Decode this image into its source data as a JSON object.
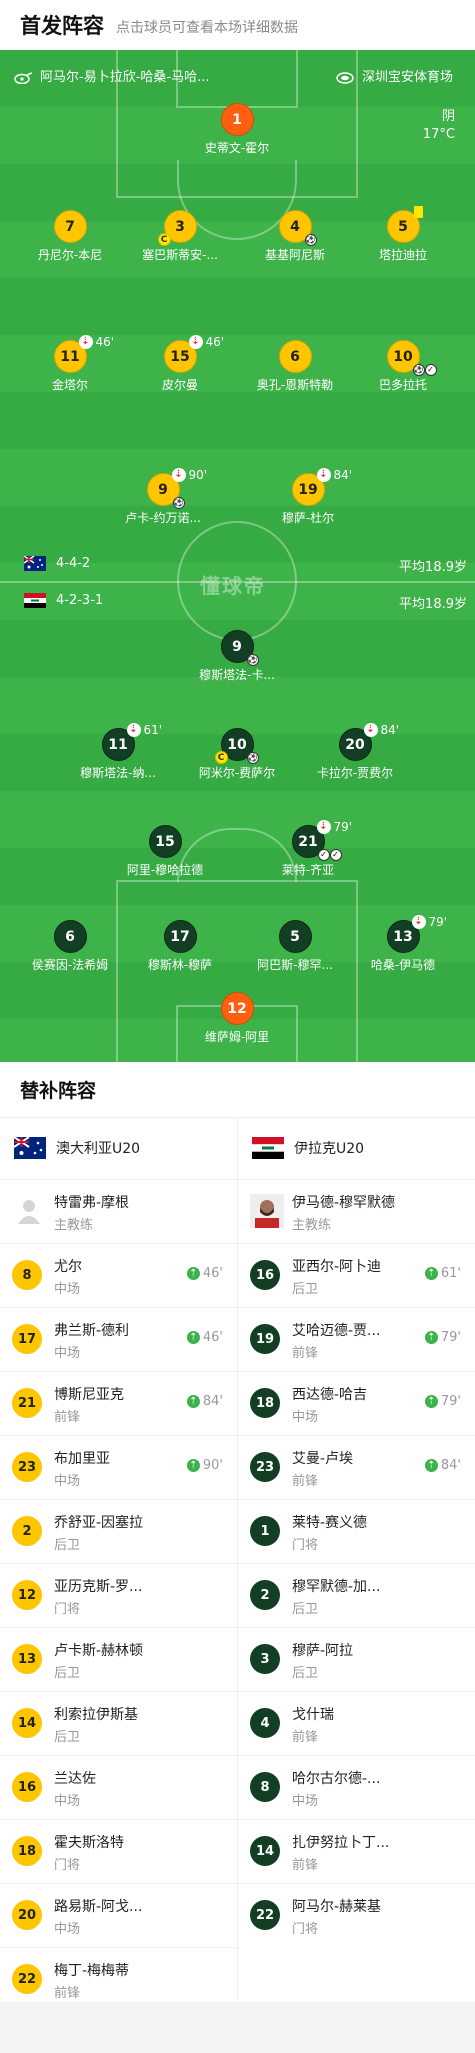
{
  "header": {
    "title": "首发阵容",
    "subtitle": "点击球员可查看本场详细数据"
  },
  "match": {
    "referee": "阿马尔-易卜拉欣-哈桑-马哈...",
    "venue": "深圳宝安体育场",
    "weather": "阴",
    "temperature": "17°C",
    "watermark": "懂球帝"
  },
  "home": {
    "formation": "4-4-2",
    "avg_age": "平均18.9岁",
    "name": "澳大利亚U20",
    "coach": "特雷弗-摩根",
    "coach_role": "主教练"
  },
  "away": {
    "formation": "4-2-3-1",
    "avg_age": "平均18.9岁",
    "name": "伊拉克U20",
    "coach": "伊马德-穆罕默德",
    "coach_role": "主教练"
  },
  "home_players": [
    {
      "num": "1",
      "name": "史蒂文-霍尔"
    },
    {
      "num": "7",
      "name": "丹尼尔-本尼"
    },
    {
      "num": "3",
      "name": "塞巴斯蒂安-..."
    },
    {
      "num": "4",
      "name": "基基阿尼斯"
    },
    {
      "num": "5",
      "name": "塔拉迪拉"
    },
    {
      "num": "11",
      "name": "金塔尔",
      "sub": "46'"
    },
    {
      "num": "15",
      "name": "皮尔曼",
      "sub": "46'"
    },
    {
      "num": "6",
      "name": "奥孔-恩斯特勒"
    },
    {
      "num": "10",
      "name": "巴多拉托"
    },
    {
      "num": "9",
      "name": "卢卡-约万诺...",
      "sub": "90'"
    },
    {
      "num": "19",
      "name": "穆萨-杜尔",
      "sub": "84'"
    }
  ],
  "away_players": [
    {
      "num": "9",
      "name": "穆斯塔法-卡..."
    },
    {
      "num": "11",
      "name": "穆斯塔法-纳...",
      "sub": "61'"
    },
    {
      "num": "10",
      "name": "阿米尔-费萨尔"
    },
    {
      "num": "20",
      "name": "卡拉尔-贾费尔",
      "sub": "84'"
    },
    {
      "num": "15",
      "name": "阿里-穆哈拉德"
    },
    {
      "num": "21",
      "name": "莱特-齐亚",
      "sub": "79'"
    },
    {
      "num": "6",
      "name": "侯赛因-法希姆"
    },
    {
      "num": "17",
      "name": "穆斯林-穆萨"
    },
    {
      "num": "5",
      "name": "阿巴斯-穆罕..."
    },
    {
      "num": "13",
      "name": "哈桑-伊马德",
      "sub": "79'"
    },
    {
      "num": "12",
      "name": "维萨姆-阿里"
    }
  ],
  "subs": {
    "title": "替补阵容",
    "home": [
      {
        "num": "8",
        "name": "尤尔",
        "pos": "中场",
        "time": "46'"
      },
      {
        "num": "17",
        "name": "弗兰斯-德利",
        "pos": "中场",
        "time": "46'"
      },
      {
        "num": "21",
        "name": "博斯尼亚克",
        "pos": "前锋",
        "time": "84'"
      },
      {
        "num": "23",
        "name": "布加里亚",
        "pos": "中场",
        "time": "90'"
      },
      {
        "num": "2",
        "name": "乔舒亚-因塞拉",
        "pos": "后卫",
        "time": ""
      },
      {
        "num": "12",
        "name": "亚历克斯-罗...",
        "pos": "门将",
        "time": ""
      },
      {
        "num": "13",
        "name": "卢卡斯-赫林顿",
        "pos": "后卫",
        "time": ""
      },
      {
        "num": "14",
        "name": "利索拉伊斯基",
        "pos": "后卫",
        "time": ""
      },
      {
        "num": "16",
        "name": "兰达佐",
        "pos": "中场",
        "time": ""
      },
      {
        "num": "18",
        "name": "霍夫斯洛特",
        "pos": "门将",
        "time": ""
      },
      {
        "num": "20",
        "name": "路易斯-阿戈...",
        "pos": "中场",
        "time": ""
      },
      {
        "num": "22",
        "name": "梅丁-梅梅蒂",
        "pos": "前锋",
        "time": ""
      }
    ],
    "away": [
      {
        "num": "16",
        "name": "亚西尔-阿卜迪",
        "pos": "后卫",
        "time": "61'"
      },
      {
        "num": "19",
        "name": "艾哈迈德-贾...",
        "pos": "前锋",
        "time": "79'"
      },
      {
        "num": "18",
        "name": "西达德-哈吉",
        "pos": "中场",
        "time": "79'"
      },
      {
        "num": "23",
        "name": "艾曼-卢埃",
        "pos": "前锋",
        "time": "84'"
      },
      {
        "num": "1",
        "name": "莱特-赛义德",
        "pos": "门将",
        "time": ""
      },
      {
        "num": "2",
        "name": "穆罕默德-加...",
        "pos": "后卫",
        "time": ""
      },
      {
        "num": "3",
        "name": "穆萨-阿拉",
        "pos": "后卫",
        "time": ""
      },
      {
        "num": "4",
        "name": "戈什瑞",
        "pos": "前锋",
        "time": ""
      },
      {
        "num": "8",
        "name": "哈尔古尔德-...",
        "pos": "中场",
        "time": ""
      },
      {
        "num": "14",
        "name": "扎伊努拉卜丁...",
        "pos": "前锋",
        "time": ""
      },
      {
        "num": "22",
        "name": "阿马尔-赫莱基",
        "pos": "门将",
        "time": ""
      }
    ]
  }
}
